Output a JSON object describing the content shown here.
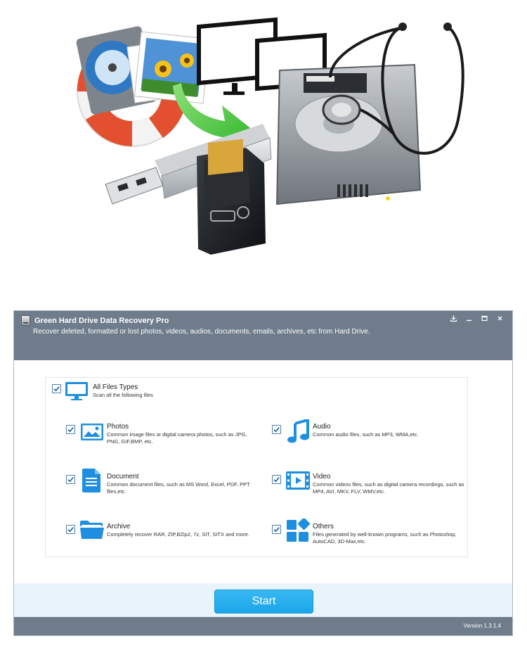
{
  "window": {
    "title": "Green Hard Drive Data Recovery Pro",
    "subtitle": "Recover deleted, formatted or lost photos, videos, audios, documents, emails, archives, etc from Hard Drive.",
    "controls": [
      "download-icon",
      "minimize-icon",
      "maximize-icon",
      "close-icon"
    ]
  },
  "all_types": {
    "title": "All Files Types",
    "desc": "Scan all the following files",
    "checked": true,
    "icon": "monitor-icon"
  },
  "types": [
    {
      "title": "Photos",
      "desc": "Common image files or digital camera photos, such as JPG, PNG, GIF,BMP, etc.",
      "checked": true,
      "icon": "photo-icon"
    },
    {
      "title": "Audio",
      "desc": "Common audio files, such as MP3, WMA,etc.",
      "checked": true,
      "icon": "music-note-icon"
    },
    {
      "title": "Document",
      "desc": "Common document files, such as MS Word, Excel, PDF, PPT files,etc.",
      "checked": true,
      "icon": "document-icon"
    },
    {
      "title": "Video",
      "desc": "Common videos files, such as digital camera recordings, such as MP4, AVI, MKV, FLV, WMV,etc.",
      "checked": true,
      "icon": "film-icon"
    },
    {
      "title": "Archive",
      "desc": "Completely recover RAR, ZIP,BZip2, 7z, SIT, SITX and more.",
      "checked": true,
      "icon": "folder-icon"
    },
    {
      "title": "Others",
      "desc": "Files generated by well-known programs, such as Photoshop, AutoCAD, 3D-Max,etc.",
      "checked": true,
      "icon": "apps-icon"
    }
  ],
  "start_label": "Start",
  "version": "Version 1.3.1.4",
  "colors": {
    "accent": "#1ea8ea",
    "titlebar": "#6e7c8b",
    "icon_blue": "#1e8fe0"
  }
}
